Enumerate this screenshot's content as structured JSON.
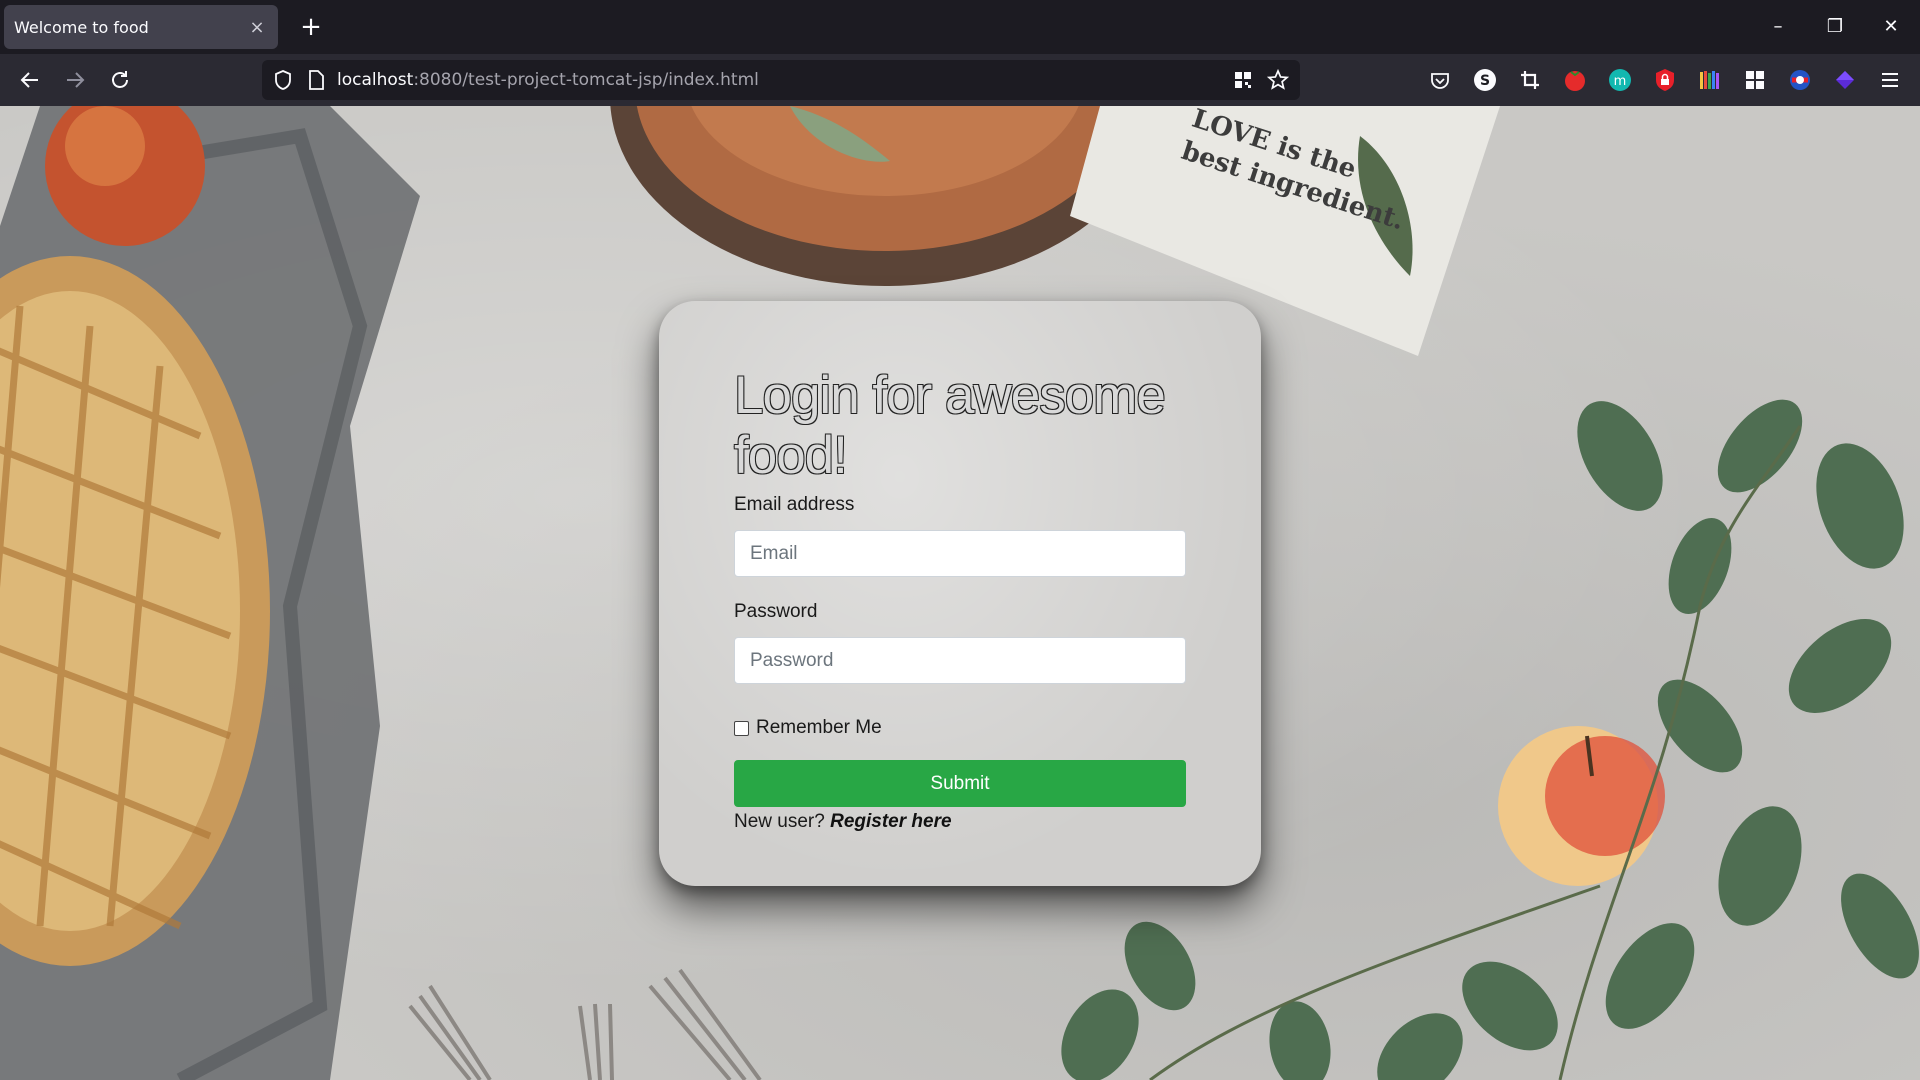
{
  "browser": {
    "tab_title": "Welcome to food",
    "tab_close": "×",
    "new_tab": "+",
    "url_host": "localhost",
    "url_rest": ":8080/test-project-tomcat-jsp/index.html",
    "window_controls": {
      "minimize": "–",
      "restore": "❐",
      "close": "✕"
    },
    "icons": [
      "back-arrow-icon",
      "forward-arrow-icon",
      "reload-icon",
      "shield-icon",
      "page-icon",
      "qr-code-icon",
      "star-icon",
      "pocket-icon",
      "s-extension-icon",
      "crop-icon",
      "tomato-extension-icon",
      "m-extension-icon",
      "lock-extension-icon",
      "library-icon",
      "grid-extension-icon",
      "flag-extension-icon",
      "diamond-extension-icon",
      "hamburger-menu-icon"
    ]
  },
  "background": {
    "napkin_text_line1": "LOVE is the",
    "napkin_text_line2": "best ingredient."
  },
  "login": {
    "title": "Login for awesome food!",
    "email_label": "Email address",
    "email_placeholder": "Email",
    "password_label": "Password",
    "password_placeholder": "Password",
    "remember_label": "Remember Me",
    "submit_label": "Submit",
    "new_user_text": "New user?",
    "register_link": "Register here"
  },
  "colors": {
    "submit_green": "#28a745",
    "chrome_dark": "#1c1b22",
    "toolbar": "#2b2a33"
  }
}
